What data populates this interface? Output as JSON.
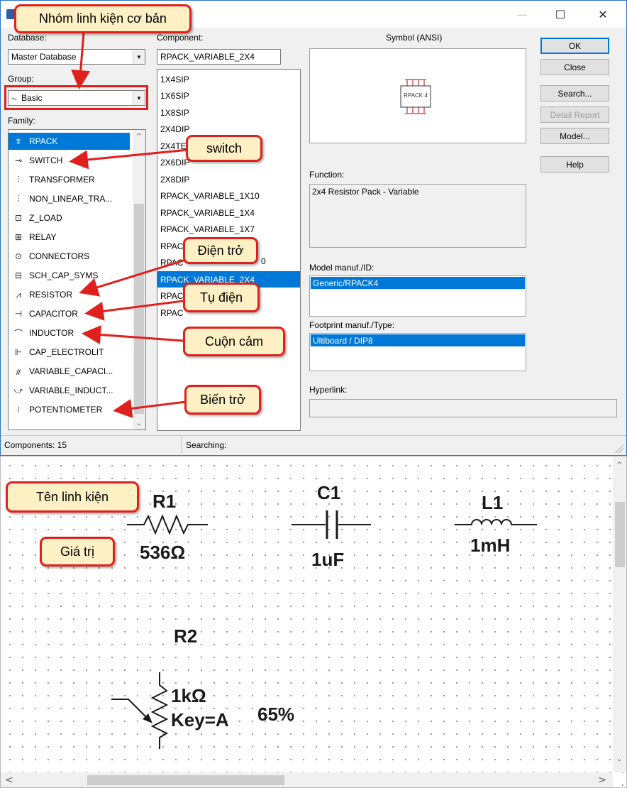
{
  "dialog": {
    "database_label": "Database:",
    "database_value": "Master Database",
    "component_label": "Component:",
    "component_value": "RPACK_VARIABLE_2X4",
    "group_label": "Group:",
    "group_value": "Basic",
    "family_label": "Family:",
    "families": [
      {
        "icon": "rpack-icon",
        "label": "RPACK",
        "selected": true
      },
      {
        "icon": "switch-icon",
        "label": "SWITCH"
      },
      {
        "icon": "transformer-icon",
        "label": "TRANSFORMER"
      },
      {
        "icon": "nonlinear-transformer-icon",
        "label": "NON_LINEAR_TRA..."
      },
      {
        "icon": "z-load-icon",
        "label": "Z_LOAD"
      },
      {
        "icon": "relay-icon",
        "label": "RELAY"
      },
      {
        "icon": "connectors-icon",
        "label": "CONNECTORS"
      },
      {
        "icon": "sch-cap-syms-icon",
        "label": "SCH_CAP_SYMS"
      },
      {
        "icon": "resistor-icon",
        "label": "RESISTOR"
      },
      {
        "icon": "capacitor-icon",
        "label": "CAPACITOR"
      },
      {
        "icon": "inductor-icon",
        "label": "INDUCTOR"
      },
      {
        "icon": "cap-electrolit-icon",
        "label": "CAP_ELECTROLIT"
      },
      {
        "icon": "variable-capacitor-icon",
        "label": "VARIABLE_CAPACI..."
      },
      {
        "icon": "variable-inductor-icon",
        "label": "VARIABLE_INDUCT..."
      },
      {
        "icon": "potentiometer-icon",
        "label": "POTENTIOMETER"
      }
    ],
    "components": [
      "1X4SIP",
      "1X6SIP",
      "1X8SIP",
      "2X4DIP",
      "2X4TE",
      "2X6DIP",
      "2X8DIP",
      "RPACK_VARIABLE_1X10",
      "RPACK_VARIABLE_1X4",
      "RPACK_VARIABLE_1X7",
      "RPAC",
      "RPAC",
      "RPACK_VARIABLE_2X4",
      "RPAC",
      "RPAC"
    ],
    "component_tail_6": "0",
    "selected_component_index": 12,
    "symbol_label": "Symbol (ANSI)",
    "symbol_chip_text": "RPACK 4",
    "function_label": "Function:",
    "function_value": "2x4 Resistor Pack - Variable",
    "model_label": "Model manuf./ID:",
    "model_value": "Generic/RPACK4",
    "footprint_label": "Footprint manuf./Type:",
    "footprint_value": "Ultiboard / DIP8",
    "hyperlink_label": "Hyperlink:",
    "buttons": {
      "ok": "OK",
      "close": "Close",
      "search": "Search...",
      "detail_report": "Detail Report",
      "model": "Model...",
      "help": "Help"
    },
    "status_components": "Components: 15",
    "status_searching": "Searching:"
  },
  "schematic": {
    "r1_name": "R1",
    "r1_value": "536Ω",
    "c1_name": "C1",
    "c1_value": "1uF",
    "l1_name": "L1",
    "l1_value": "1mH",
    "r2_name": "R2",
    "r2_value": "1kΩ",
    "r2_key": "Key=A",
    "r2_percent": "65%"
  },
  "callouts": {
    "group": "Nhóm linh kiện cơ bản",
    "switch": "switch",
    "resistor": "Điện trở",
    "capacitor": "Tụ điện",
    "inductor": "Cuộn cảm",
    "potentiometer": "Biến trở",
    "name": "Tên linh kiện",
    "value": "Giá trị"
  },
  "colors": {
    "selection": "#0078d7",
    "callout_border": "#e0201c",
    "callout_fill": "#fdf0c4"
  }
}
